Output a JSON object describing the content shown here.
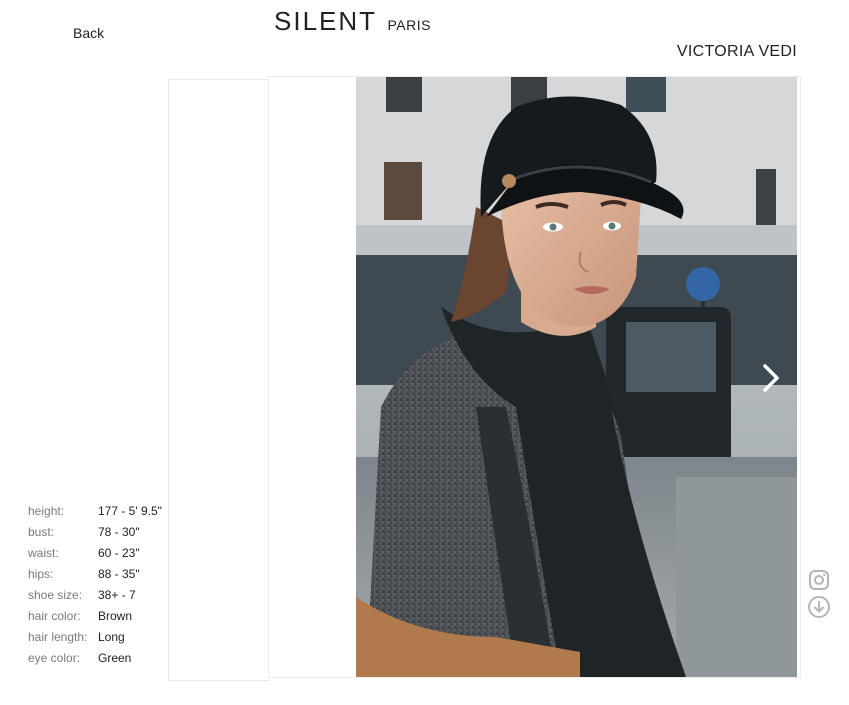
{
  "nav": {
    "back_label": "Back"
  },
  "brand": {
    "name": "SILENT",
    "city": "PARIS"
  },
  "model": {
    "name": "VICTORIA VEDI"
  },
  "measurements": [
    {
      "label": "height:",
      "value": "177 - 5' 9.5\""
    },
    {
      "label": "bust:",
      "value": "78 - 30\""
    },
    {
      "label": "waist:",
      "value": "60 - 23\""
    },
    {
      "label": "hips:",
      "value": "88 - 35\""
    },
    {
      "label": "shoe size:",
      "value": "38+ - 7"
    },
    {
      "label": "hair color:",
      "value": "Brown"
    },
    {
      "label": "hair length:",
      "value": "Long"
    },
    {
      "label": "eye color:",
      "value": "Green"
    }
  ],
  "gallery": {
    "next_icon": "chevron-right-icon"
  },
  "social": {
    "icons": [
      "instagram-icon",
      "download-icon"
    ]
  }
}
